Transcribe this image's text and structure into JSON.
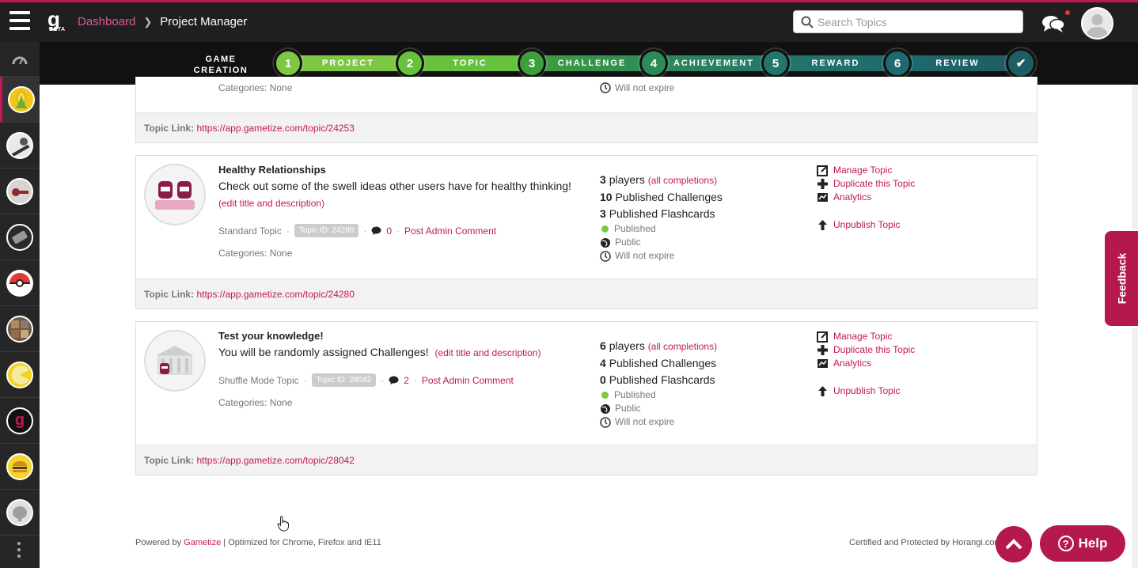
{
  "header": {
    "logo_text": "g",
    "logo_badge": "BETA",
    "breadcrumb": {
      "root": "Dashboard",
      "current": "Project Manager"
    },
    "search_placeholder": "Search Topics"
  },
  "progress": {
    "title": "GAME CREATION PROGRESS",
    "steps": [
      {
        "num": "1",
        "label": "PROJECT",
        "color": "#7dc742"
      },
      {
        "num": "2",
        "label": "TOPIC",
        "color": "#66c23d"
      },
      {
        "num": "3",
        "label": "CHALLENGE",
        "color": "#3f9e3c"
      },
      {
        "num": "4",
        "label": "ACHIEVEMENT",
        "color": "#2d8a58"
      },
      {
        "num": "5",
        "label": "REWARD",
        "color": "#23766a"
      },
      {
        "num": "6",
        "label": "REVIEW",
        "color": "#1f6a6e"
      },
      {
        "num": "✔",
        "label": "",
        "color": "#1e5d63"
      }
    ]
  },
  "colors": {
    "accent": "#c2185b",
    "topbar": "#1f1f1f",
    "sidebar": "#262626"
  },
  "sidebar": {
    "items": [
      {
        "icon": "dashboard-gauge-icon"
      },
      {
        "icon": "corn-topic-icon"
      },
      {
        "icon": "billiard-topic-icon"
      },
      {
        "icon": "keys-topic-icon"
      },
      {
        "icon": "device-topic-icon"
      },
      {
        "icon": "pokeball-topic-icon"
      },
      {
        "icon": "collage-topic-icon"
      },
      {
        "icon": "pacman-topic-icon"
      },
      {
        "icon": "gametize-topic-icon"
      },
      {
        "icon": "burger-topic-icon"
      },
      {
        "icon": "elephant-topic-icon"
      }
    ]
  },
  "partial_card": {
    "categories": "Categories: None",
    "expire": "Will not expire",
    "link_label": "Topic Link:",
    "link_url": "https://app.gametize.com/topic/24253"
  },
  "topics": [
    {
      "title": "Healthy Relationships",
      "description": "Check out some of the swell ideas other users have for healthy thinking!",
      "edit_label": "(edit title and description)",
      "type": "Standard Topic",
      "topic_id": "Topic ID: 24280",
      "comments": "0",
      "post_comment": "Post Admin Comment",
      "categories": "Categories: None",
      "players_count": "3",
      "players_label": "players",
      "completions": "(all completions)",
      "challenges_count": "10",
      "challenges_label": "Published Challenges",
      "flashcards_count": "3",
      "flashcards_label": "Published Flashcards",
      "status": "Published",
      "visibility": "Public",
      "expiry": "Will not expire",
      "manage": "Manage Topic",
      "duplicate": "Duplicate this Topic",
      "analytics": "Analytics",
      "unpublish": "Unpublish Topic",
      "link_label": "Topic Link:",
      "link_url": "https://app.gametize.com/topic/24280"
    },
    {
      "title": "Test your knowledge!",
      "description": "You will be randomly assigned Challenges!",
      "edit_label": "(edit title and description)",
      "type": "Shuffle Mode Topic",
      "topic_id": "Topic ID: 28042",
      "comments": "2",
      "post_comment": "Post Admin Comment",
      "categories": "Categories: None",
      "players_count": "6",
      "players_label": "players",
      "completions": "(all completions)",
      "challenges_count": "4",
      "challenges_label": "Published Challenges",
      "flashcards_count": "0",
      "flashcards_label": "Published Flashcards",
      "status": "Published",
      "visibility": "Public",
      "expiry": "Will not expire",
      "manage": "Manage Topic",
      "duplicate": "Duplicate this Topic",
      "analytics": "Analytics",
      "unpublish": "Unpublish Topic",
      "link_label": "Topic Link:",
      "link_url": "https://app.gametize.com/topic/28042"
    }
  ],
  "footer": {
    "powered_prefix": "Powered by",
    "powered_brand": "Gametize",
    "powered_suffix": "| Optimized for Chrome, Firefox and IE11",
    "certified": "Certified and Protected by Horangi.com"
  },
  "floating": {
    "feedback": "Feedback",
    "help": "Help"
  }
}
